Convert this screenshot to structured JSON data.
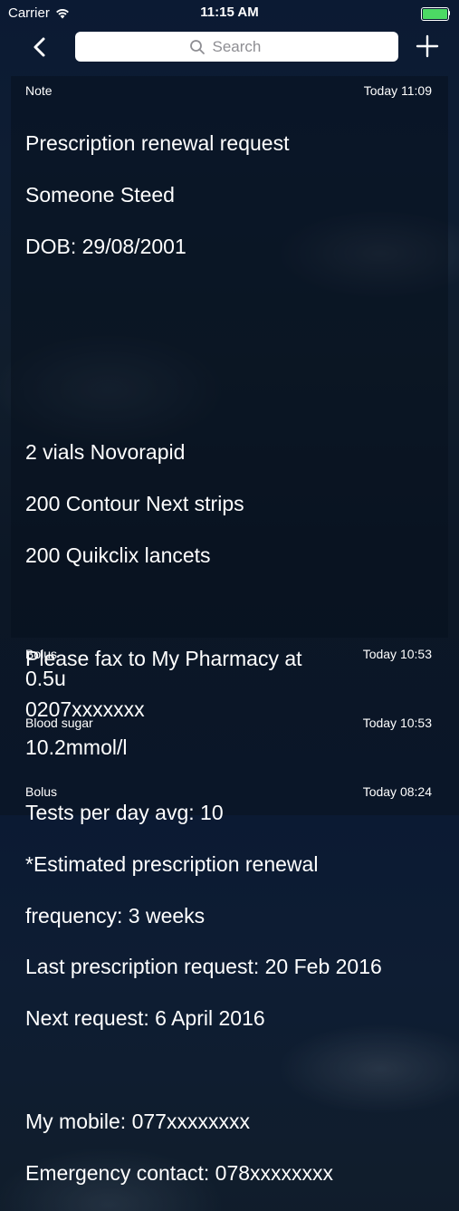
{
  "status_bar": {
    "carrier": "Carrier",
    "time": "11:15 AM",
    "battery_color": "#4cd964",
    "battery_level": 1.0
  },
  "nav": {
    "back_icon": "chevron-left-icon",
    "search_placeholder": "Search",
    "add_icon": "plus-icon"
  },
  "entries": [
    {
      "type": "Note",
      "time": "Today 11:09",
      "lines": [
        "Prescription renewal request",
        "Someone Steed",
        "DOB: 29/08/2001",
        "",
        "",
        "",
        "2 vials Novorapid",
        "200 Contour Next strips",
        "200 Quikclix lancets",
        "",
        "Please fax to My Pharmacy at",
        "0207xxxxxxx",
        "",
        "Tests per day avg: 10",
        "*Estimated prescription renewal",
        "frequency: 3 weeks",
        "Last prescription request: 20 Feb 2016",
        "Next request: 6 April 2016",
        "",
        "My mobile: 077xxxxxxxx",
        "Emergency contact: 078xxxxxxxx"
      ]
    },
    {
      "type": "Bolus",
      "time": "Today 10:53",
      "value": "0.5u"
    },
    {
      "type": "Blood sugar",
      "time": "Today 10:53",
      "value": "10.2mmol/l"
    },
    {
      "type": "Bolus",
      "time": "Today 08:24",
      "value": ""
    }
  ]
}
